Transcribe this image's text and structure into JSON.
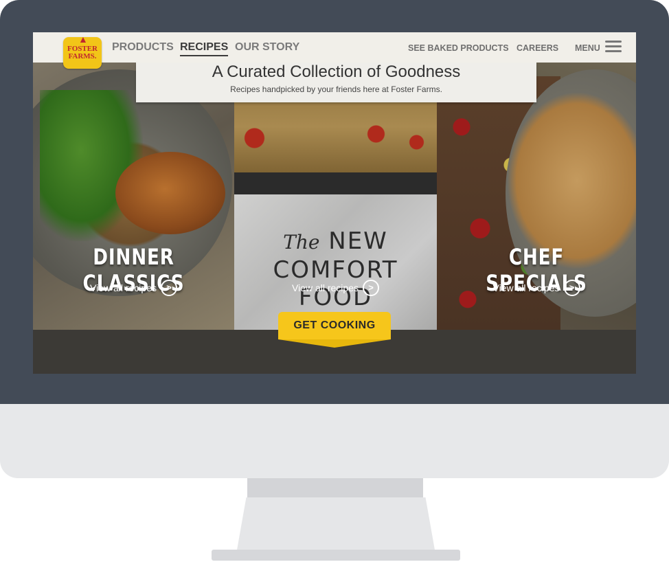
{
  "nav": {
    "logo_text": "FOSTER FARMS.",
    "items": [
      {
        "label": "PRODUCTS"
      },
      {
        "label": "RECIPES",
        "active": true
      },
      {
        "label": "OUR STORY"
      }
    ],
    "right_items": [
      {
        "label": "SEE BAKED PRODUCTS"
      },
      {
        "label": "CAREERS"
      },
      {
        "label": "MENU"
      }
    ]
  },
  "banner": {
    "title": "A Curated Collection of Goodness",
    "subtitle": "Recipes handpicked by your friends here at Foster Farms."
  },
  "panels": [
    {
      "title": "DINNER CLASSICS",
      "link": "View all recipes"
    },
    {
      "title_lines": [
        "The",
        "NEW",
        "COMFORT",
        "FOOD"
      ],
      "link": "View all recipes"
    },
    {
      "title": "CHEF SPECIALS",
      "link": "View all recipes"
    }
  ],
  "cta": {
    "label": "GET COOKING"
  },
  "colors": {
    "brand_yellow": "#f6c61b",
    "brand_red": "#c0272d",
    "bezel": "#434b57"
  },
  "icons": [
    "rooster-icon",
    "menu-icon",
    "chevron-right-icon"
  ]
}
